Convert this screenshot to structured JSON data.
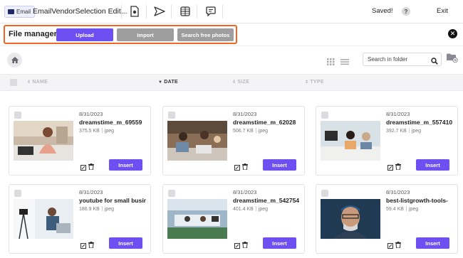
{
  "topbar": {
    "email_badge": "Email",
    "doc_title": "EmailVendorSelection Edit...",
    "icons": [
      "document-icon",
      "send-icon",
      "globe-icon",
      "comment-icon"
    ],
    "saved": "Saved!",
    "help": "?",
    "exit": "Exit"
  },
  "file_manager": {
    "title": "File manager",
    "upload": "Upload",
    "import": "Import",
    "search_free_photos": "Search free photos",
    "highlight_color": "#f26522",
    "accent_color": "#6e4ff2"
  },
  "toolbar": {
    "search_placeholder": "Search in folder"
  },
  "columns": {
    "name": "NAME",
    "date": "DATE",
    "size": "SIZE",
    "type": "TYPE"
  },
  "files": [
    {
      "date": "8/31/2023",
      "name": "dreamstime_m_69559",
      "size": "375.5 KB",
      "type": "jpeg",
      "insert": "Insert"
    },
    {
      "date": "8/31/2023",
      "name": "dreamstime_m_62028",
      "size": "506.7 KB",
      "type": "jpeg",
      "insert": "Insert"
    },
    {
      "date": "8/31/2023",
      "name": "dreamstime_m_557410",
      "size": "392.7 KB",
      "type": "jpeg",
      "insert": "Insert"
    },
    {
      "date": "8/31/2023",
      "name": "youtube for small busin",
      "size": "186.9 KB",
      "type": "jpeg",
      "insert": "Insert"
    },
    {
      "date": "8/31/2023",
      "name": "dreamstime_m_542754",
      "size": "401.4 KB",
      "type": "jpeg",
      "insert": "Insert"
    },
    {
      "date": "8/31/2023",
      "name": "best-listgrowth-tools-",
      "size": "59.4 KB",
      "type": "jpeg",
      "insert": "Insert"
    }
  ]
}
